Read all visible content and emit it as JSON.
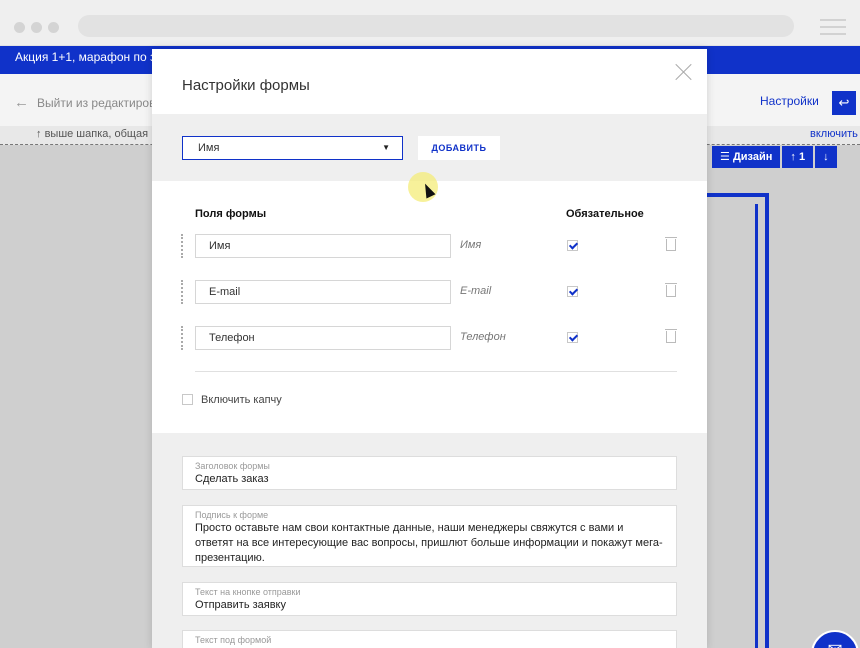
{
  "promo": {
    "text": "Акция 1+1, марафон по зап"
  },
  "subheader": {
    "back_label": "Выйти из редактиров",
    "settings_label": "Настройки",
    "undo_icon": "undo-icon"
  },
  "ruler": {
    "left_text": "выше шапка, общая",
    "right_text": "включить"
  },
  "toolbar_behind": {
    "design_label": "Дизайн",
    "page_num": "1"
  },
  "modal": {
    "title": "Настройки формы",
    "select_value": "Имя",
    "add_button": "добавить",
    "fields_header": "Поля формы",
    "required_header": "Обязательное",
    "fields": [
      {
        "value": "Имя",
        "placeholder": "Имя",
        "required": true
      },
      {
        "value": "E-mail",
        "placeholder": "E-mail",
        "required": true
      },
      {
        "value": "Телефон",
        "placeholder": "Телефон",
        "required": true
      }
    ],
    "captcha_label": "Включить капчу",
    "text_fields": [
      {
        "label": "Заголовок формы",
        "value": "Сделать заказ"
      },
      {
        "label": "Подпись к форме",
        "value": "Просто оставьте нам свои контактные данные, наши менеджеры свяжутся с вами и ответят на все интересующие вас вопросы, пришлют больше информации и покажут мега-презентацию."
      },
      {
        "label": "Текст на кнопке отправки",
        "value": "Отправить заявку"
      },
      {
        "label": "Текст под формой",
        "value": ""
      }
    ]
  },
  "colors": {
    "accent": "#1032c9",
    "section_bg": "#efefef"
  }
}
